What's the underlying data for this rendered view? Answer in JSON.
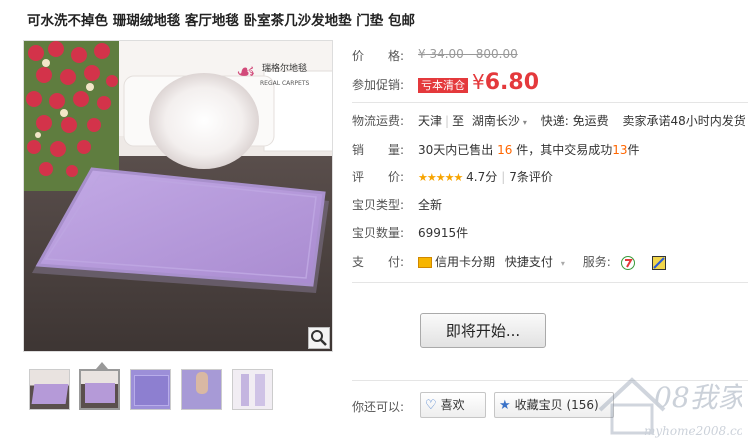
{
  "title": "可水洗不掉色 珊瑚绒地毯 客厅地毯 卧室茶几沙发地垫 门垫 包邮",
  "brand_logo_text": "瑞格尔地毯",
  "brand_logo_sub": "REGAL CARPETS",
  "labels": {
    "price": "价　　格:",
    "promo": "参加促销:",
    "shipping": "物流运费:",
    "sales": "销　　量:",
    "rating": "评　　价:",
    "type": "宝贝类型:",
    "stock": "宝贝数量:",
    "pay": "支　　付:",
    "share": "你还可以:"
  },
  "price": {
    "original": "¥ 34.00 - 800.00"
  },
  "promo": {
    "tag": "亏本清仓",
    "currency": "¥",
    "amount": "6.80"
  },
  "shipping": {
    "from": "天津",
    "to_label": "至",
    "to": "湖南长沙",
    "delivery": "快递: 免运费",
    "promise": "卖家承诺48小时内发货"
  },
  "sales": {
    "prefix": "30天内已售出",
    "sold": "16",
    "mid": "件，其中交易成功",
    "success": "13",
    "suffix": "件"
  },
  "rating": {
    "stars": "★★★★★",
    "score": "4.7分",
    "count": "7条评价"
  },
  "type_value": "全新",
  "stock_value": "69915件",
  "pay": {
    "credit": "信用卡分期",
    "fast": "快捷支付",
    "service_label": "服务:"
  },
  "buy_button": "即将开始...",
  "share": {
    "like": "喜欢",
    "collect": "收藏宝贝 (156)"
  },
  "watermark": {
    "main": "08我家",
    "url": "myhome2008.com"
  },
  "colors": {
    "accent_red": "#e4393c",
    "orange": "#ff6600",
    "mat_purple": "#b59ad8"
  }
}
